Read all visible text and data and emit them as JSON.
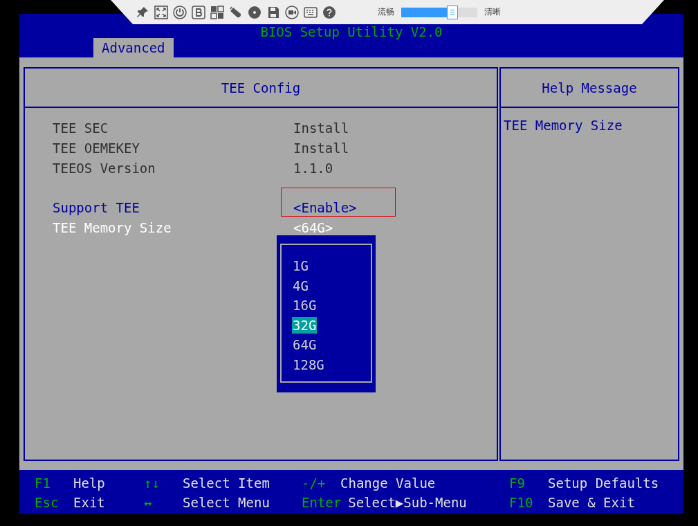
{
  "toolbar": {
    "quality": {
      "low_label": "流畅",
      "high_label": "清晰",
      "level": 0.67
    }
  },
  "title": "BIOS Setup Utility V2.0",
  "tabs": [
    {
      "label": "Advanced",
      "selected": true
    }
  ],
  "panel": {
    "title": "TEE Config",
    "items": [
      {
        "kind": "info",
        "label": "TEE SEC",
        "value": "Install",
        "selected": false
      },
      {
        "kind": "info",
        "label": "TEE OEMEKEY",
        "value": "Install",
        "selected": false
      },
      {
        "kind": "info",
        "label": "TEEOS Version",
        "value": "1.1.0",
        "selected": false
      },
      {
        "kind": "gap"
      },
      {
        "kind": "option",
        "label": "Support TEE",
        "value": "<Enable>",
        "selected": false,
        "marked": true
      },
      {
        "kind": "option",
        "label": "TEE Memory Size",
        "value": "<64G>",
        "selected": true
      }
    ]
  },
  "dropdown": {
    "options": [
      {
        "label": "1G",
        "selected": false
      },
      {
        "label": "4G",
        "selected": false
      },
      {
        "label": "16G",
        "selected": false
      },
      {
        "label": "32G",
        "selected": true
      },
      {
        "label": "64G",
        "selected": false
      },
      {
        "label": "128G",
        "selected": false
      }
    ]
  },
  "help": {
    "title": "Help Message",
    "text": "TEE Memory Size"
  },
  "footer": [
    {
      "key": "F1",
      "action": "Help"
    },
    {
      "key": "Esc",
      "action": "Exit"
    },
    {
      "key": "↑↓",
      "action": "Select Item"
    },
    {
      "key": "↔",
      "action": "Select Menu"
    },
    {
      "key": "-/+",
      "action": "Change Value"
    },
    {
      "key": "Enter",
      "action": "Select▶Sub-Menu"
    },
    {
      "key": "F9",
      "action": "Setup Defaults"
    },
    {
      "key": "F10",
      "action": "Save & Exit"
    }
  ]
}
